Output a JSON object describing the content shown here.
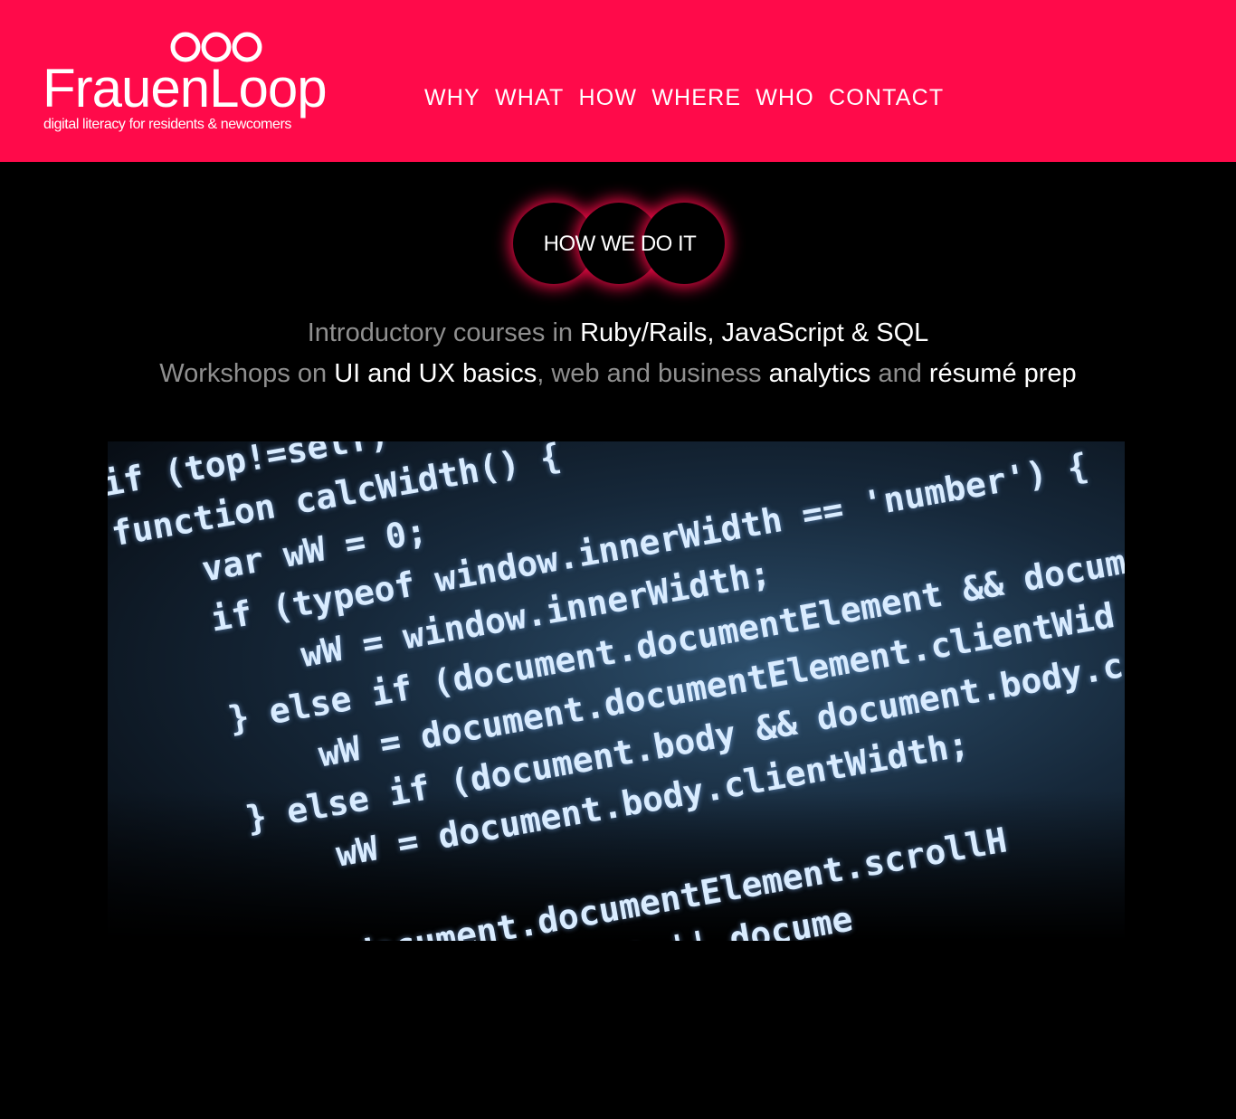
{
  "header": {
    "logo_word": "FrauenLoop",
    "logo_tagline": "digital literacy for residents & newcomers",
    "accent_color": "#ff0a4a"
  },
  "nav": {
    "items": [
      "WHY",
      "WHAT",
      "HOW",
      "WHERE",
      "WHO",
      "CONTACT"
    ]
  },
  "section": {
    "badge": "HOW WE DO IT",
    "line1": {
      "lead": "Introductory courses in ",
      "topics": "Ruby/Rails, JavaScript & SQL"
    },
    "line2": {
      "lead": "Workshops on ",
      "t1": "UI and UX basics",
      "sep": ", web and business ",
      "t2": "analytics",
      "and": " and ",
      "t3": "résumé prep"
    }
  },
  "image": {
    "description_icon": "code-screen-photo",
    "code_lines": [
      "if (top!=self)",
      "function calcWidth() {",
      "    var wW = 0;",
      "    if (typeof window.innerWidth == 'number') {",
      "        wW = window.innerWidth;",
      "    } else if (document.documentElement && docum",
      "        wW = document.documentElement.clientWid",
      "    } else if (document.body && document.body.c",
      "        wW = document.body.clientWidth;",
      "",
      "        document.documentElement.scrollH",
      "    }   ...innerHeight || docume"
    ]
  }
}
